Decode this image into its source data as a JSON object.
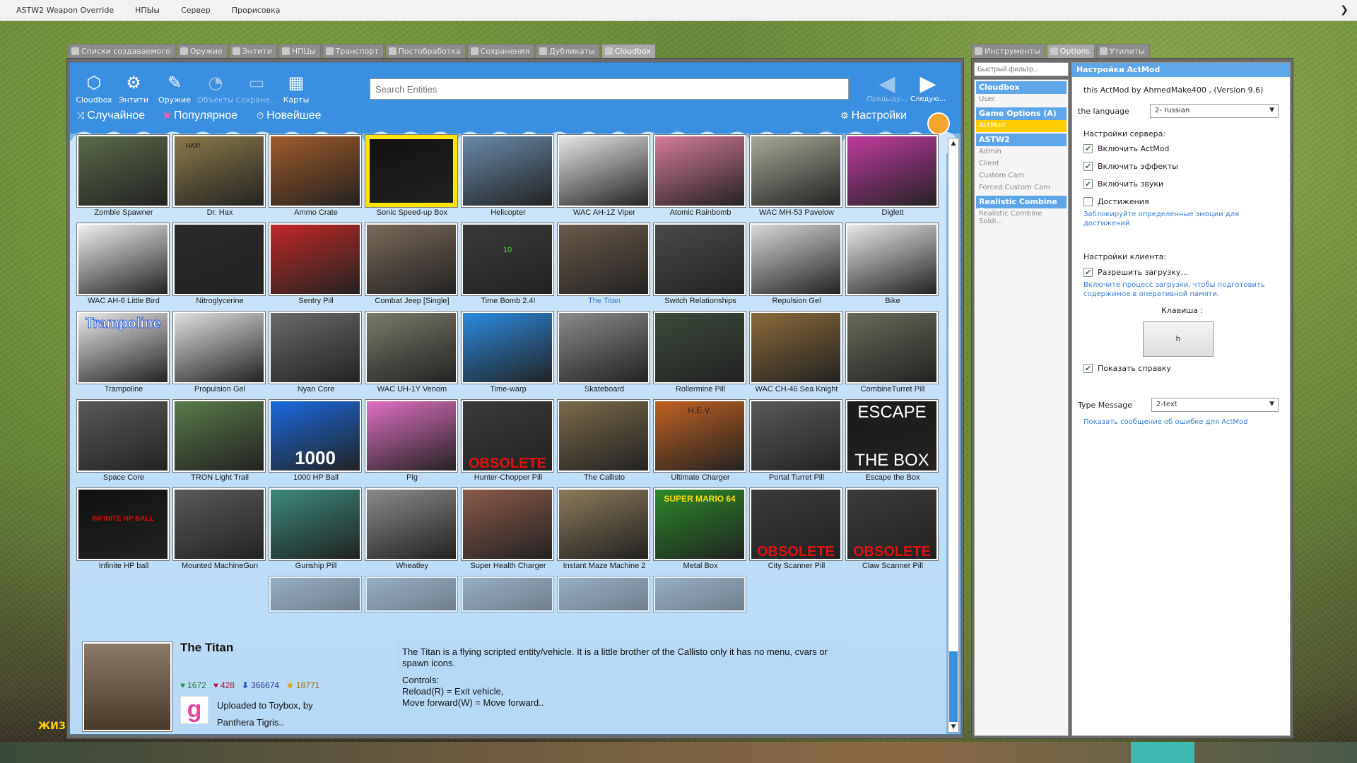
{
  "menubar": {
    "items": [
      "ASTW2 Weapon Override",
      "НПЫы",
      "Сервер",
      "Прорисовка"
    ]
  },
  "tabs": [
    {
      "label": "Списки создаваемого",
      "active": false
    },
    {
      "label": "Оружие",
      "active": false
    },
    {
      "label": "Энтити",
      "active": false
    },
    {
      "label": "НПЦы",
      "active": false
    },
    {
      "label": "Транспорт",
      "active": false
    },
    {
      "label": "Постобработка",
      "active": false
    },
    {
      "label": "Сохранения",
      "active": false
    },
    {
      "label": "Дубликаты",
      "active": false
    },
    {
      "label": "Cloudbox",
      "active": true
    }
  ],
  "toolbar": {
    "buttons": [
      {
        "label": "Cloudbox",
        "icon": "cube-icon",
        "disabled": false
      },
      {
        "label": "Энтити",
        "icon": "entity-icon",
        "disabled": false
      },
      {
        "label": "Оружие",
        "icon": "weapon-icon",
        "disabled": false
      },
      {
        "label": "Объекты",
        "icon": "object-icon",
        "disabled": true
      },
      {
        "label": "Сохране...",
        "icon": "folder-icon",
        "disabled": true
      },
      {
        "label": "Карты",
        "icon": "map-icon",
        "disabled": false
      }
    ],
    "search_placeholder": "Search Entities",
    "prev_label": "Предыду...",
    "next_label": "Следую..."
  },
  "sort": {
    "random": "Случайное",
    "popular": "Популярное",
    "newest": "Новейшее",
    "settings": "Настройки"
  },
  "items": [
    {
      "name": "Zombie Spawner",
      "color": "#5a6a4a"
    },
    {
      "name": "Dr. Hax",
      "color": "#8a7a4a"
    },
    {
      "name": "Ammo Crate",
      "color": "#a05a28"
    },
    {
      "name": "Sonic Speed-up Box",
      "color": "#111111"
    },
    {
      "name": "Helicopter",
      "color": "#6a8aa8"
    },
    {
      "name": "WAC AH-1Z Viper",
      "color": "#e6e6e6"
    },
    {
      "name": "Atomic Rainbomb",
      "color": "#d67a9a"
    },
    {
      "name": "WAC MH-53 Pavelow",
      "color": "#a8a898"
    },
    {
      "name": "Diglett",
      "color": "#c03aa0"
    },
    {
      "name": "WAC AH-6 Little Bird",
      "color": "#f0f0f0"
    },
    {
      "name": "Nitroglycerine",
      "color": "#2a2a2a"
    },
    {
      "name": "Sentry Pill",
      "color": "#c02828"
    },
    {
      "name": "Combat Jeep [Single]",
      "color": "#7a6a5a"
    },
    {
      "name": "Time Bomb 2.4!",
      "color": "#3a3a3a"
    },
    {
      "name": "The Titan",
      "color": "#6a5a4a"
    },
    {
      "name": "Switch Relationships",
      "color": "#4a4a4a"
    },
    {
      "name": "Repulsion Gel",
      "color": "#d8d8d8"
    },
    {
      "name": "Bike",
      "color": "#e8e8e8"
    },
    {
      "name": "Trampoline",
      "color": "#e8e8e8"
    },
    {
      "name": "Propulsion Gel",
      "color": "#e0e0e0"
    },
    {
      "name": "Nyan Core",
      "color": "#6a6a6a"
    },
    {
      "name": "WAC UH-1Y Venom",
      "color": "#7a7a6a"
    },
    {
      "name": "Time-warp",
      "color": "#2a8ae0"
    },
    {
      "name": "Skateboard",
      "color": "#8a8a8a"
    },
    {
      "name": "Rollermine Pill",
      "color": "#3a4a3a"
    },
    {
      "name": "WAC CH-46 Sea Knight",
      "color": "#8a6a3a"
    },
    {
      "name": "CombineTurret Pill",
      "color": "#6a6a5a"
    },
    {
      "name": "Space Core",
      "color": "#5a5a5a"
    },
    {
      "name": "TRON Light Trail",
      "color": "#5a7a4a"
    },
    {
      "name": "1000 HP Ball",
      "color": "#1a6ae0"
    },
    {
      "name": "Pig",
      "color": "#e070c0"
    },
    {
      "name": "Hunter-Chopper Pill",
      "color": "#3a3a3a"
    },
    {
      "name": "The Callisto",
      "color": "#7a6a4a"
    },
    {
      "name": "Ultimate Charger",
      "color": "#c06020"
    },
    {
      "name": "Portal Turret Pill",
      "color": "#5a5a5a"
    },
    {
      "name": "Escape the Box",
      "color": "#1a1a1a"
    },
    {
      "name": "Infinite HP ball",
      "color": "#111111"
    },
    {
      "name": "Mounted MachineGun",
      "color": "#5a5a5a"
    },
    {
      "name": "Gunship Pill",
      "color": "#3a8a7a"
    },
    {
      "name": "Wheatley",
      "color": "#8a8a8a"
    },
    {
      "name": "Super Health Charger",
      "color": "#8a5a4a"
    },
    {
      "name": "Instant Maze Machine 2",
      "color": "#8a7a5a"
    },
    {
      "name": "Metal Box",
      "color": "#2a8a2a"
    },
    {
      "name": "City Scanner Pill",
      "color": "#3a3a3a"
    },
    {
      "name": "Claw Scanner Pill",
      "color": "#3a3a3a"
    }
  ],
  "overlay_texts": {
    "obsolete": "OBSOLETE",
    "escape_top": "ESCAPE",
    "escape_bottom": "THE BOX",
    "trampoline": "Trampoline",
    "hp1000": "1000",
    "infinite": "INFINITE HP BALL",
    "hax": "HAX!",
    "mario": "SUPER MARIO 64",
    "hev": "H.E.V.",
    "timebomb": "10"
  },
  "selected": {
    "title": "The Titan",
    "likes": "1672",
    "dislikes": "428",
    "downloads": "366674",
    "favorites": "18771",
    "uploaded_line1": "Uploaded to Toybox, by",
    "uploaded_line2": "Panthera Tigris..",
    "g_letter": "g",
    "desc_line1": "The Titan is a flying scripted entity/vehicle. It is a little brother of the Callisto only it has no menu, cvars or",
    "desc_line2": "spawn icons.",
    "desc_line3": "Controls:",
    "desc_line4": "Reload(R) = Exit vehicle,",
    "desc_line5": "Move forward(W) = Move forward.."
  },
  "right": {
    "tabs": [
      {
        "label": "Инструменты",
        "active": false
      },
      {
        "label": "Options",
        "active": true
      },
      {
        "label": "Утилиты",
        "active": false
      }
    ],
    "filter_placeholder": "Быстрый фильтр...",
    "list": [
      {
        "type": "cat",
        "label": "Cloudbox"
      },
      {
        "type": "sub",
        "label": "User"
      },
      {
        "type": "cat",
        "label": "Game Options (A)"
      },
      {
        "type": "sel",
        "label": "ActMod"
      },
      {
        "type": "cat",
        "label": "ASTW2"
      },
      {
        "type": "sub",
        "label": "Admin"
      },
      {
        "type": "sub",
        "label": "Client"
      },
      {
        "type": "sub",
        "label": "Custom Cam"
      },
      {
        "type": "sub",
        "label": "Forced Custom Cam"
      },
      {
        "type": "cat",
        "label": "Realistic Combine S..."
      },
      {
        "type": "sub",
        "label": "Realistic Combine Soldi..."
      }
    ],
    "settings": {
      "header": "Настройки ActMod",
      "version": "this ActMod by AhmedMake400 , (Version 9.6)",
      "lang_label": "the language",
      "lang_value": "2- russian",
      "server_settings": "Настройки сервера:",
      "enable_actmod": "Включить ActMod",
      "enable_effects": "Включить эффекты",
      "enable_sounds": "Включить звуки",
      "achievements": "Достижения",
      "achievements_hint": "Заблокируйте определенные эмоции для достижений",
      "client_settings": "Настройки клиента:",
      "allow_loading": "Разрешить загрузку...",
      "loading_hint": "Включите процесс загрузки, чтобы подготовить содержимое в оперативной памяти.",
      "key_label": "Клавиша :",
      "key_value": "h",
      "show_help": "Показать справку",
      "type_msg_label": "Type Message",
      "type_msg_value": "2-text",
      "show_error": "Показать сообщение об ошибке для ActMod"
    }
  },
  "hud": {
    "text": "ЖИЗ"
  }
}
